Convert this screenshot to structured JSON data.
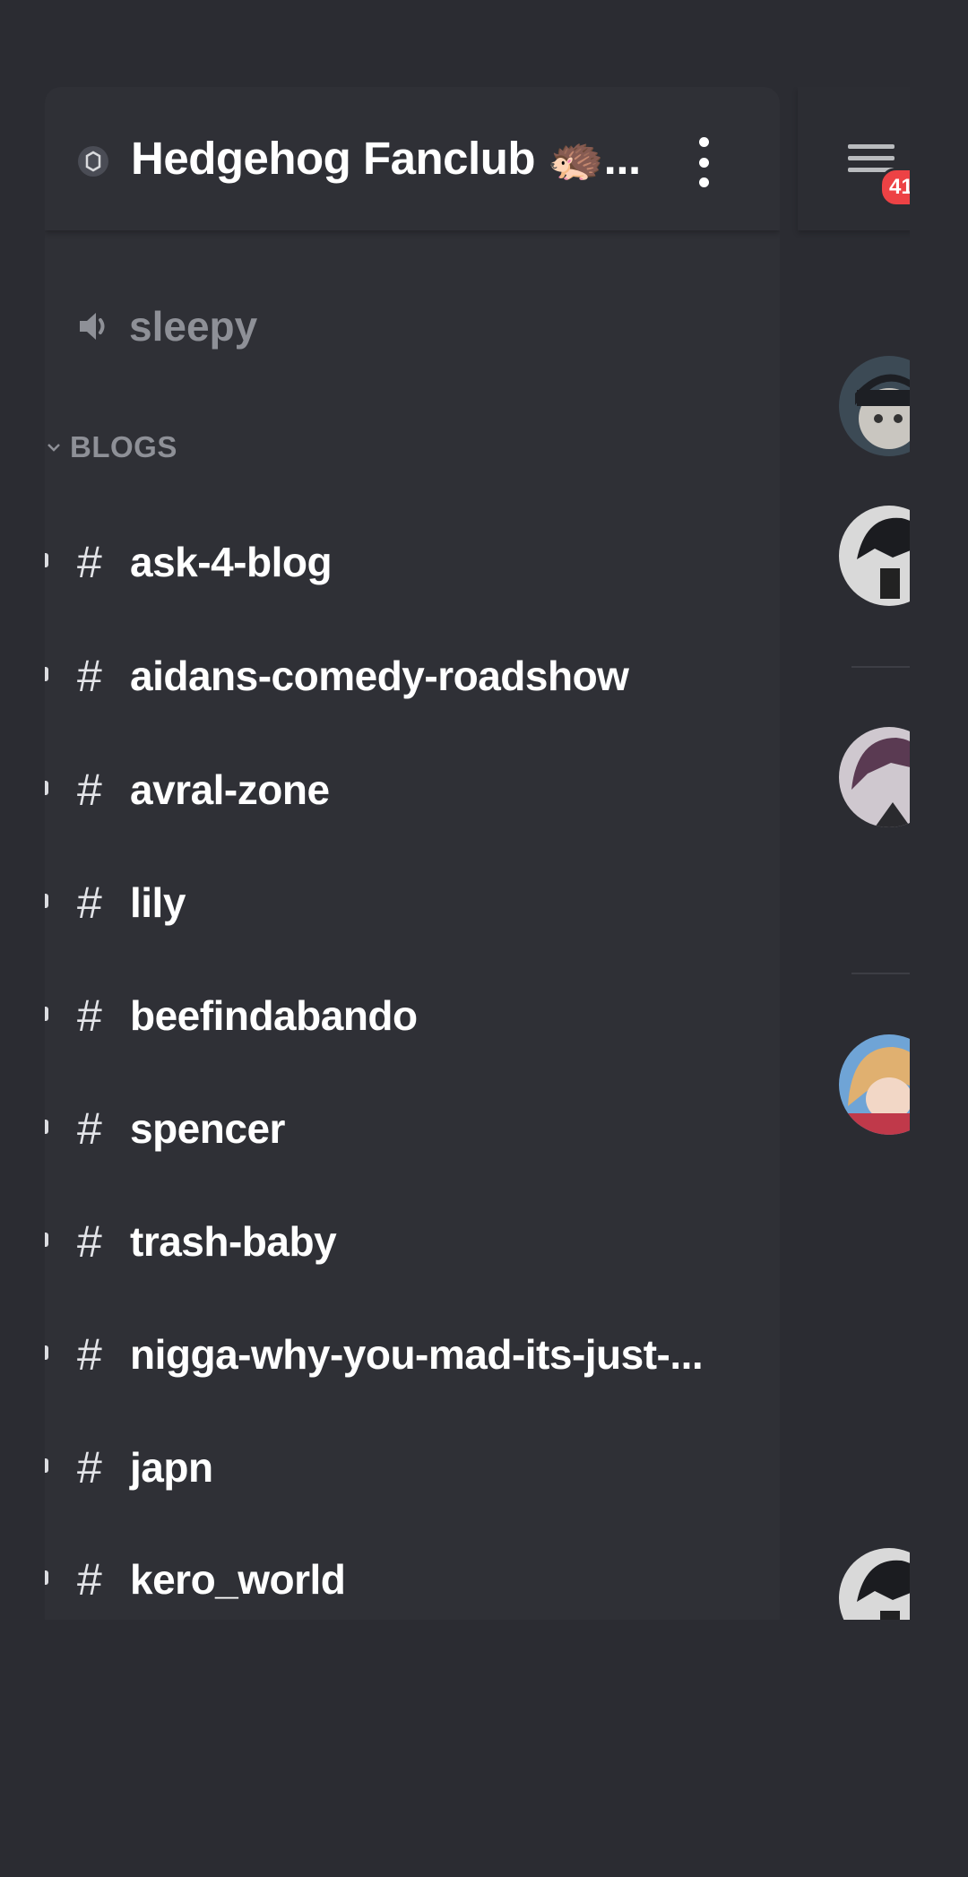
{
  "server": {
    "name": "Hedgehog Fanclub 🦔...",
    "menu_icon": "kebab-menu-icon"
  },
  "voice_channel": {
    "icon": "speaker-icon",
    "label": "sleepy"
  },
  "category": {
    "icon": "chevron-down-icon",
    "label": "BLOGS"
  },
  "channels": [
    {
      "hash": "#",
      "name": "ask-4-blog"
    },
    {
      "hash": "#",
      "name": "aidans-comedy-roadshow"
    },
    {
      "hash": "#",
      "name": "avral-zone"
    },
    {
      "hash": "#",
      "name": "lily"
    },
    {
      "hash": "#",
      "name": "beefindabando"
    },
    {
      "hash": "#",
      "name": "spencer"
    },
    {
      "hash": "#",
      "name": "trash-baby"
    },
    {
      "hash": "#",
      "name": "nigga-why-you-mad-its-just-..."
    },
    {
      "hash": "#",
      "name": "japn"
    },
    {
      "hash": "#",
      "name": "kero_world"
    }
  ],
  "chat": {
    "menu_icon": "hamburger-icon",
    "badge": "41"
  },
  "colors": {
    "background": "#2b2c32",
    "sidebar": "#2f3036",
    "text_primary": "#ffffff",
    "text_muted": "#8e9097",
    "badge": "#ed4245"
  }
}
